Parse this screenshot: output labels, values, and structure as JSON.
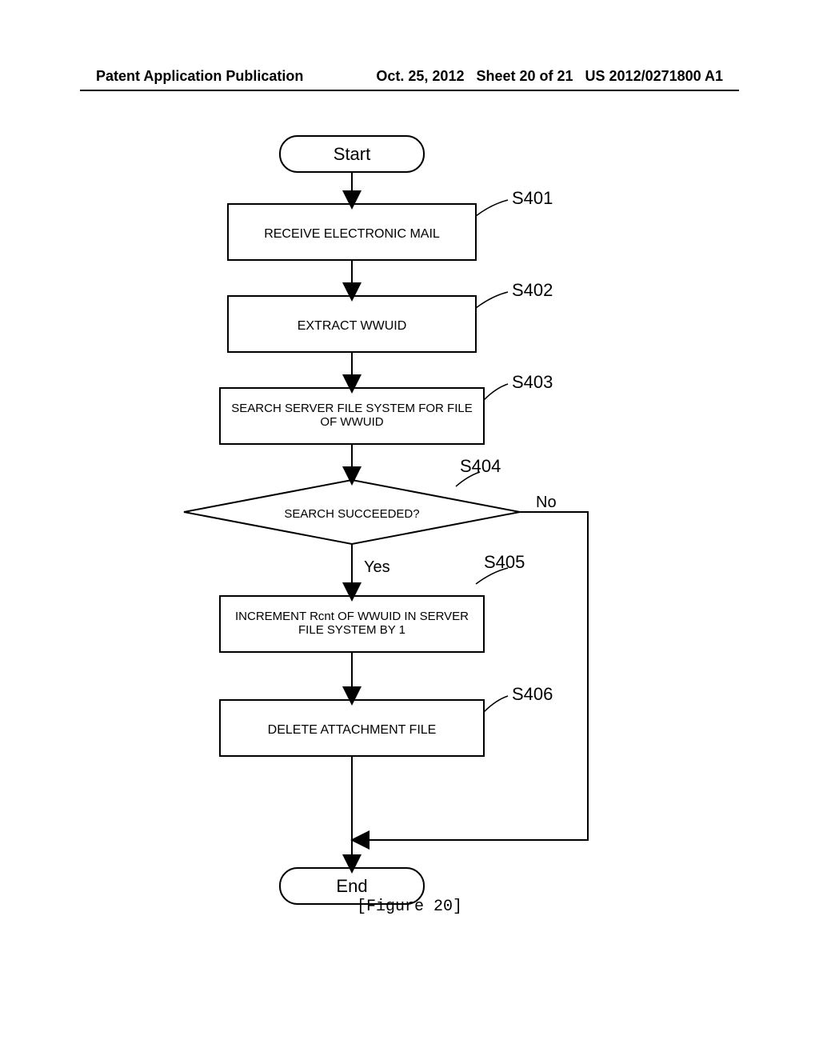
{
  "header": {
    "publication_type": "Patent Application Publication",
    "date": "Oct. 25, 2012",
    "sheet": "Sheet 20 of 21",
    "pub_number": "US 2012/0271800 A1"
  },
  "flowchart": {
    "start": "Start",
    "step_s401": {
      "label": "S401",
      "text": "RECEIVE ELECTRONIC MAIL"
    },
    "step_s402": {
      "label": "S402",
      "text": "EXTRACT WWUID"
    },
    "step_s403": {
      "label": "S403",
      "text_line1": "SEARCH SERVER FILE SYSTEM FOR FILE",
      "text_line2": "OF WWUID"
    },
    "step_s404": {
      "label": "S404",
      "text": "SEARCH SUCCEEDED?",
      "yes": "Yes",
      "no": "No"
    },
    "step_s405": {
      "label": "S405",
      "text_line1": "INCREMENT Rcnt OF WWUID IN SERVER",
      "text_line2": "FILE SYSTEM BY 1"
    },
    "step_s406": {
      "label": "S406",
      "text": "DELETE ATTACHMENT FILE"
    },
    "end": "End"
  },
  "caption": "[Figure 20]"
}
